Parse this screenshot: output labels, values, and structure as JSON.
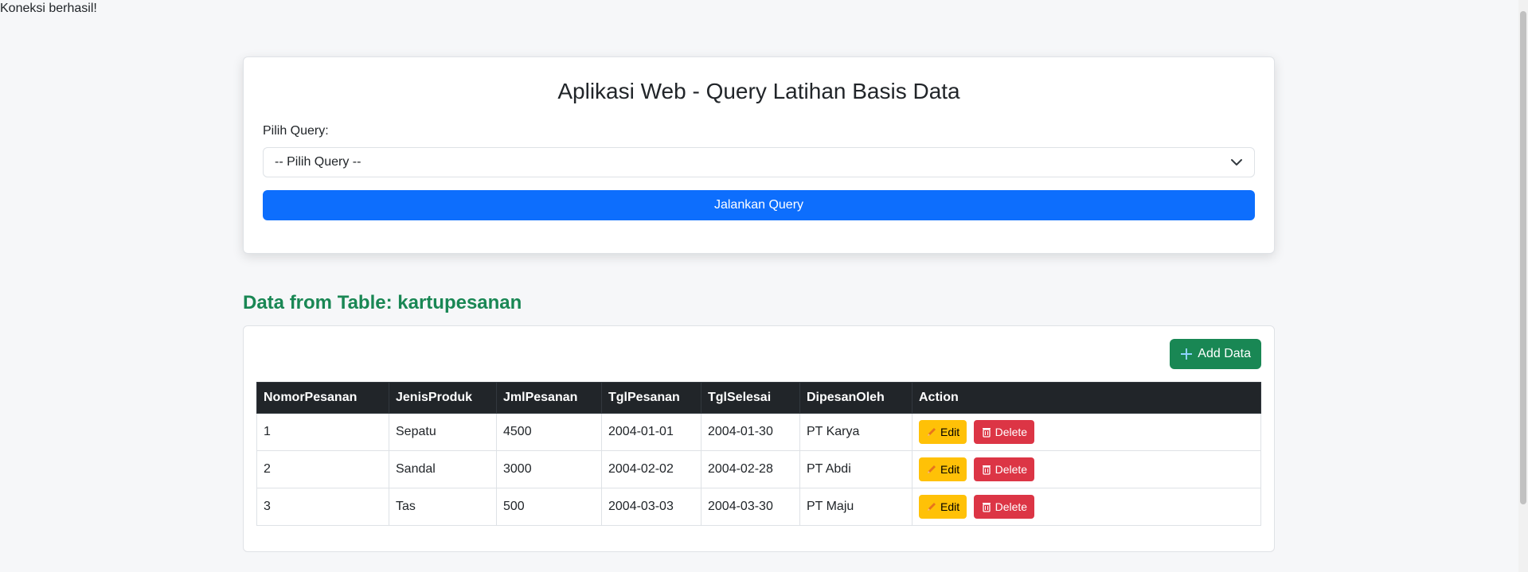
{
  "status_message": "Koneksi berhasil!",
  "query_panel": {
    "title": "Aplikasi Web - Query Latihan Basis Data",
    "select_label": "Pilih Query:",
    "select_value": "-- Pilih Query --",
    "run_button": "Jalankan Query"
  },
  "data_section": {
    "title": "Data from Table: kartupesanan",
    "add_button": "Add Data",
    "columns": [
      "NomorPesanan",
      "JenisProduk",
      "JmlPesanan",
      "TglPesanan",
      "TglSelesai",
      "DipesanOleh",
      "Action"
    ],
    "rows": [
      [
        "1",
        "Sepatu",
        "4500",
        "2004-01-01",
        "2004-01-30",
        "PT Karya"
      ],
      [
        "2",
        "Sandal",
        "3000",
        "2004-02-02",
        "2004-02-28",
        "PT Abdi"
      ],
      [
        "3",
        "Tas",
        "500",
        "2004-03-03",
        "2004-03-30",
        "PT Maju"
      ]
    ],
    "edit_label": "Edit",
    "delete_label": "Delete"
  },
  "colors": {
    "primary": "#0d6efd",
    "success": "#198754",
    "warning": "#ffc107",
    "danger": "#dc3545",
    "table_header": "#212529"
  },
  "icons": {
    "add": "plus-icon",
    "edit": "pencil-icon",
    "delete": "trash-icon",
    "select": "chevron-down-icon"
  }
}
